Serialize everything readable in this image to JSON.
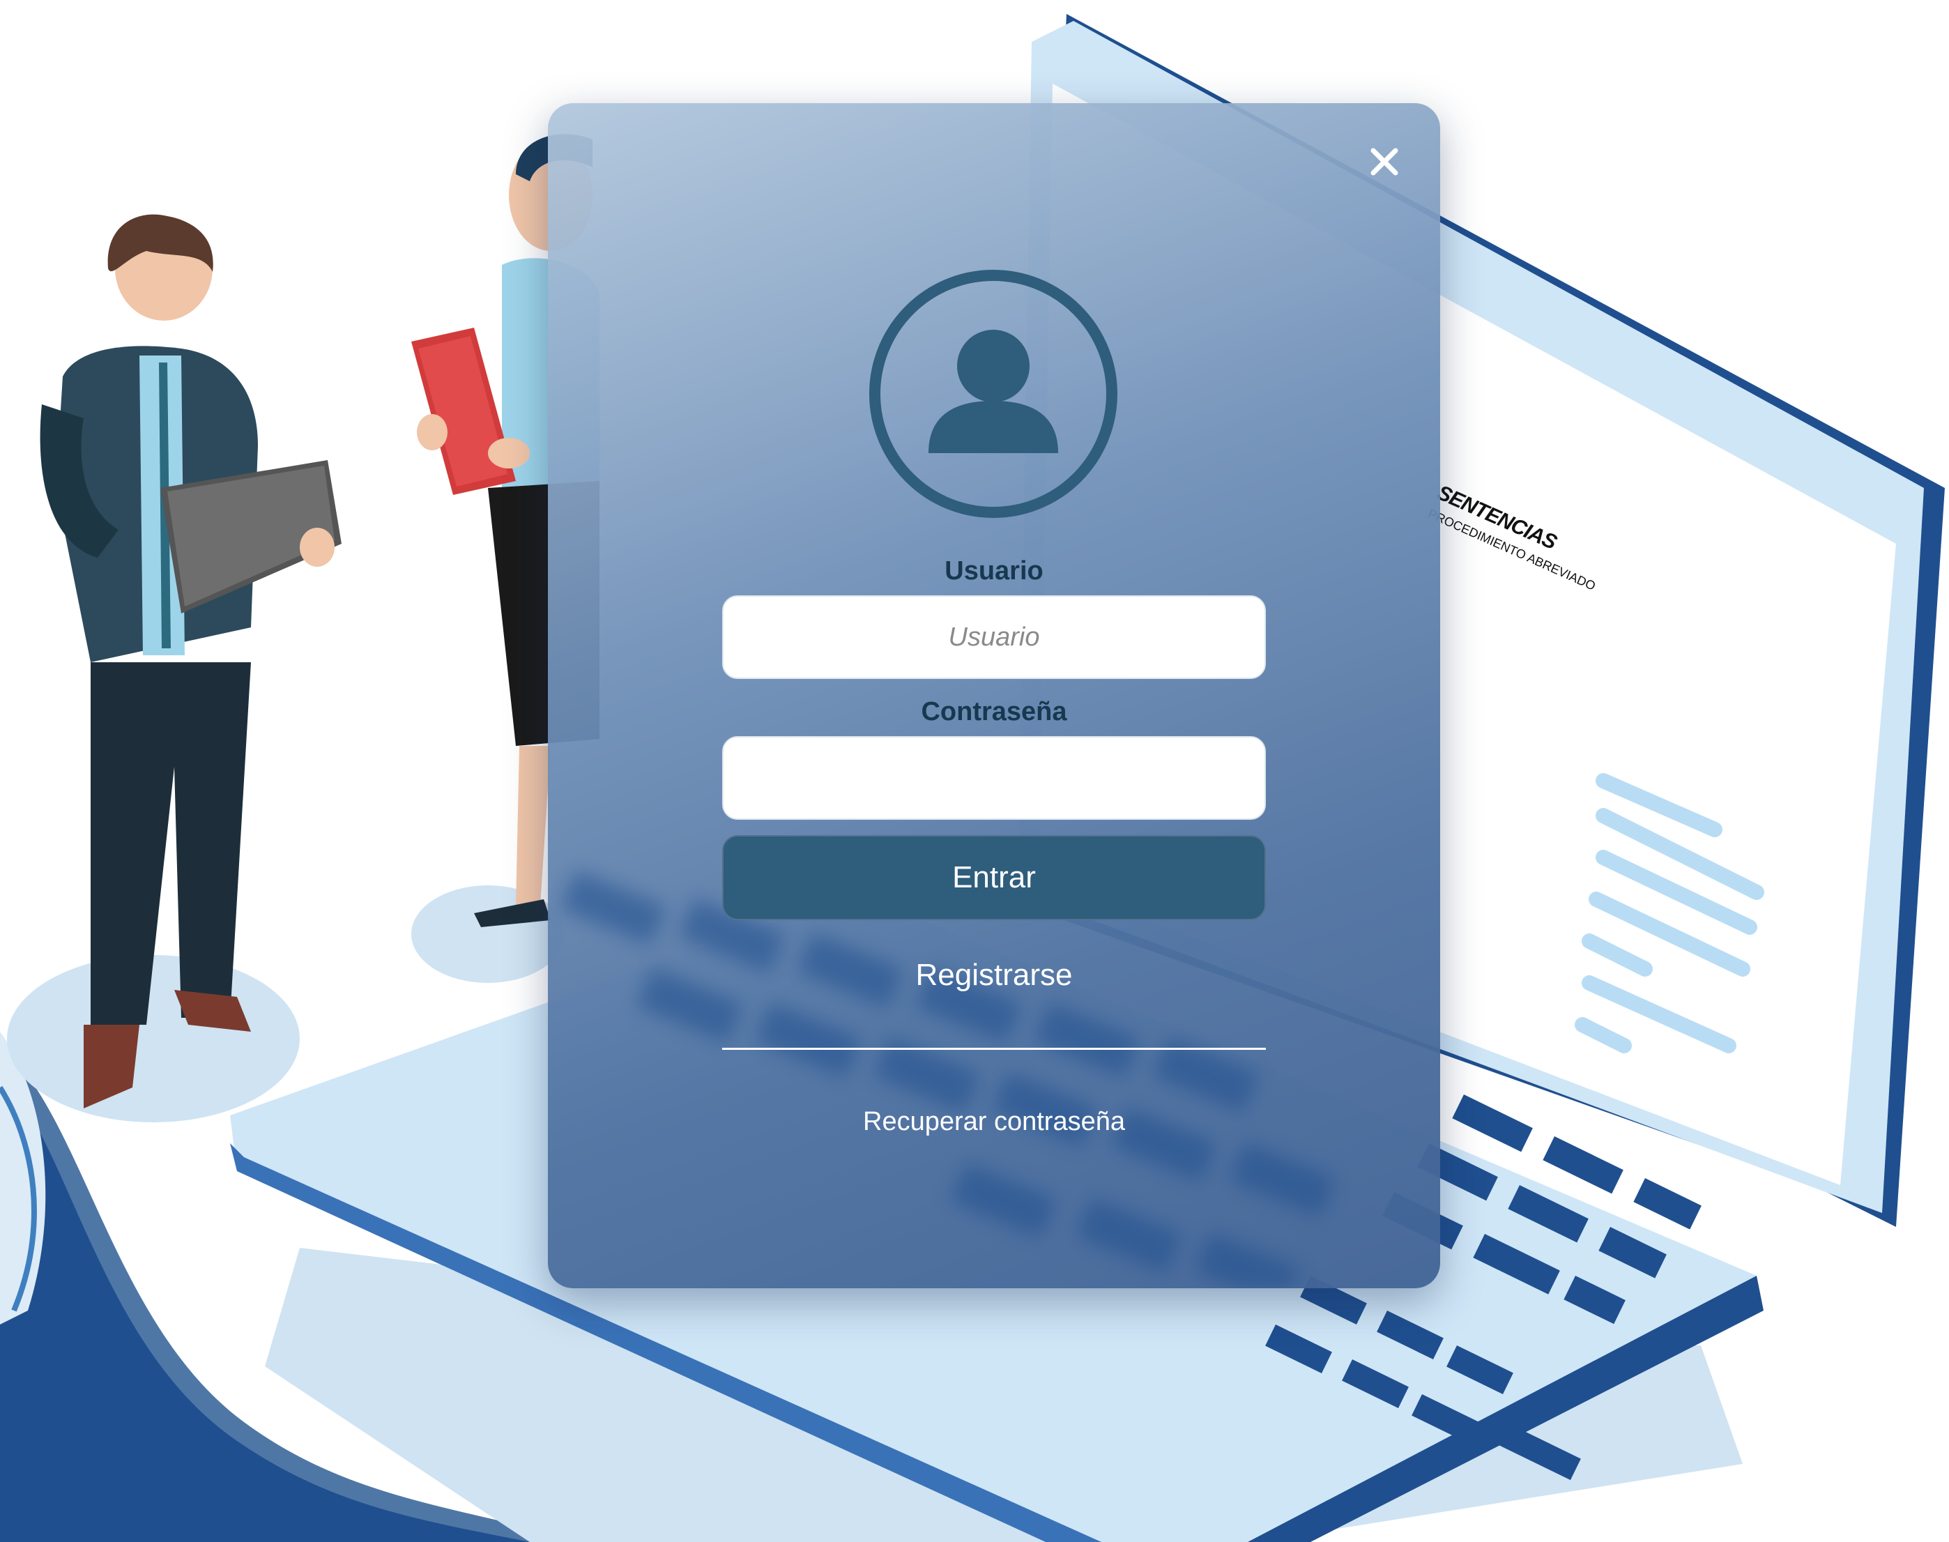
{
  "background": {
    "screen_title": "SENTENCIAS",
    "screen_subtitle": "PROCEDIMIENTO ABREVIADO"
  },
  "login": {
    "close_symbol": "×",
    "username_label": "Usuario",
    "username_placeholder": "Usuario",
    "username_value": "",
    "password_label": "Contraseña",
    "password_value": "",
    "enter_label": "Entrar",
    "register_label": "Registrarse",
    "recover_label": "Recuperar contraseña"
  },
  "icons": {
    "close": "close-icon",
    "avatar": "user-avatar-icon"
  },
  "colors": {
    "primary_button": "#2f5d7c",
    "label_text": "#17384f",
    "laptop_dark": "#1f4f8f",
    "laptop_light": "#cfe6f7"
  }
}
